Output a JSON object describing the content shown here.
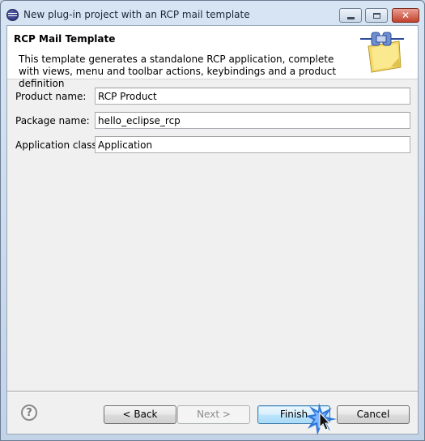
{
  "window": {
    "title": "New plug-in project with an RCP mail template",
    "controls": [
      "minimize",
      "maximize",
      "close"
    ]
  },
  "header": {
    "title": "RCP Mail Template",
    "description": "This template generates a standalone RCP application, complete with views, menu and toolbar actions, keybindings and a product definition",
    "image_icon": "wizard-plug-banner-icon"
  },
  "form": {
    "product_name": {
      "label": "Product name:",
      "value": "RCP Product"
    },
    "package_name": {
      "label": "Package name:",
      "value": "hello_eclipse_rcp"
    },
    "application_class": {
      "label": "Application class:",
      "value": "Application"
    }
  },
  "buttons": {
    "help": "?",
    "back": "< Back",
    "next": "Next >",
    "finish": "Finish",
    "cancel": "Cancel"
  },
  "colors": {
    "title_bar": "#c9d7e8",
    "dialog_bg": "#f0f0f0",
    "header_bg": "#ffffff",
    "default_button_border": "#3c7fb1",
    "cursor_highlight": "#1f6bd6"
  }
}
